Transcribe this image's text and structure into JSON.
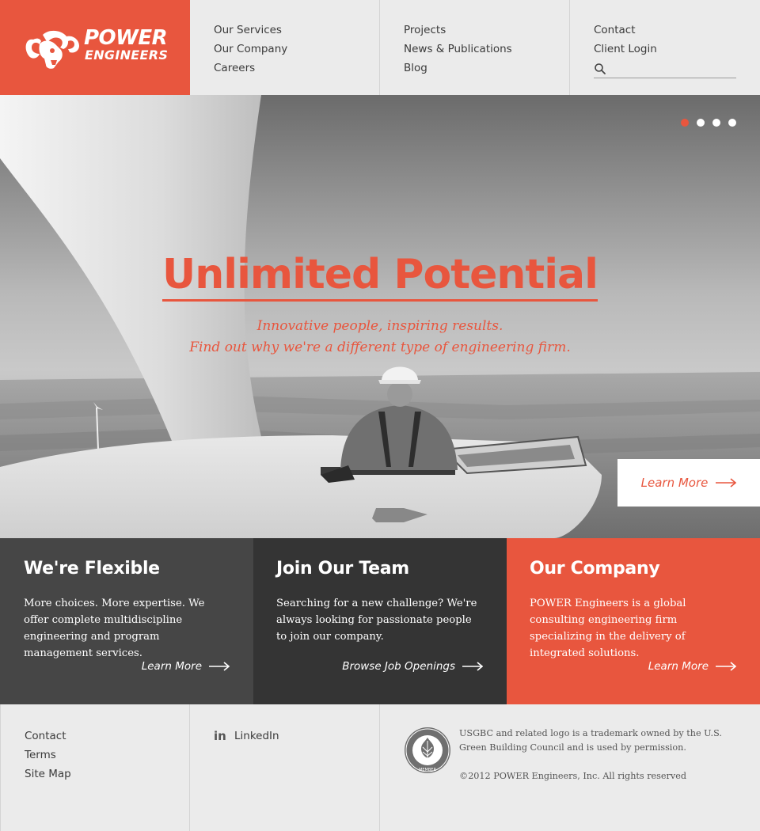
{
  "brand": {
    "name_line1": "POWER",
    "name_line2": "ENGINEERS",
    "primary_color": "#e8563e"
  },
  "nav": {
    "col1": [
      "Our Services",
      "Our Company",
      "Careers"
    ],
    "col2": [
      "Projects",
      "News & Publications",
      "Blog"
    ],
    "col3": [
      "Contact",
      "Client Login"
    ],
    "search": {
      "icon": "search-icon",
      "placeholder": "",
      "value": ""
    }
  },
  "hero": {
    "title": "Unlimited Potential",
    "subtitle_line1": "Innovative people, inspiring results.",
    "subtitle_line2": "Find out why we're a different type of engineering firm.",
    "cta_label": "Learn More",
    "slides": {
      "count": 4,
      "active_index": 0
    }
  },
  "panels": [
    {
      "title": "We're Flexible",
      "body": "More choices. More expertise. We offer complete multidiscipline engineering and program management services.",
      "link": "Learn More",
      "color": "#464646"
    },
    {
      "title": "Join Our Team",
      "body": "Searching for a new challenge? We're always looking for passionate people to join our company.",
      "link": "Browse Job Openings",
      "color": "#343434"
    },
    {
      "title": "Our Company",
      "body": "POWER Engineers is a global consulting engineering firm specializing in the delivery of integrated solutions.",
      "link": "Learn More",
      "color": "#e8563e"
    }
  ],
  "footer": {
    "links": [
      "Contact",
      "Terms",
      "Site Map"
    ],
    "social": {
      "icon": "linkedin-icon",
      "label": "LinkedIn"
    },
    "usgbc_notice": "USGBC and related logo is a trademark owned by the U.S. Green Building Council and is used by permission.",
    "seal_text": "U.S. GREEN BUILDING COUNCIL MEMBER",
    "copyright": "©2012 POWER Engineers, Inc. All rights reserved"
  }
}
